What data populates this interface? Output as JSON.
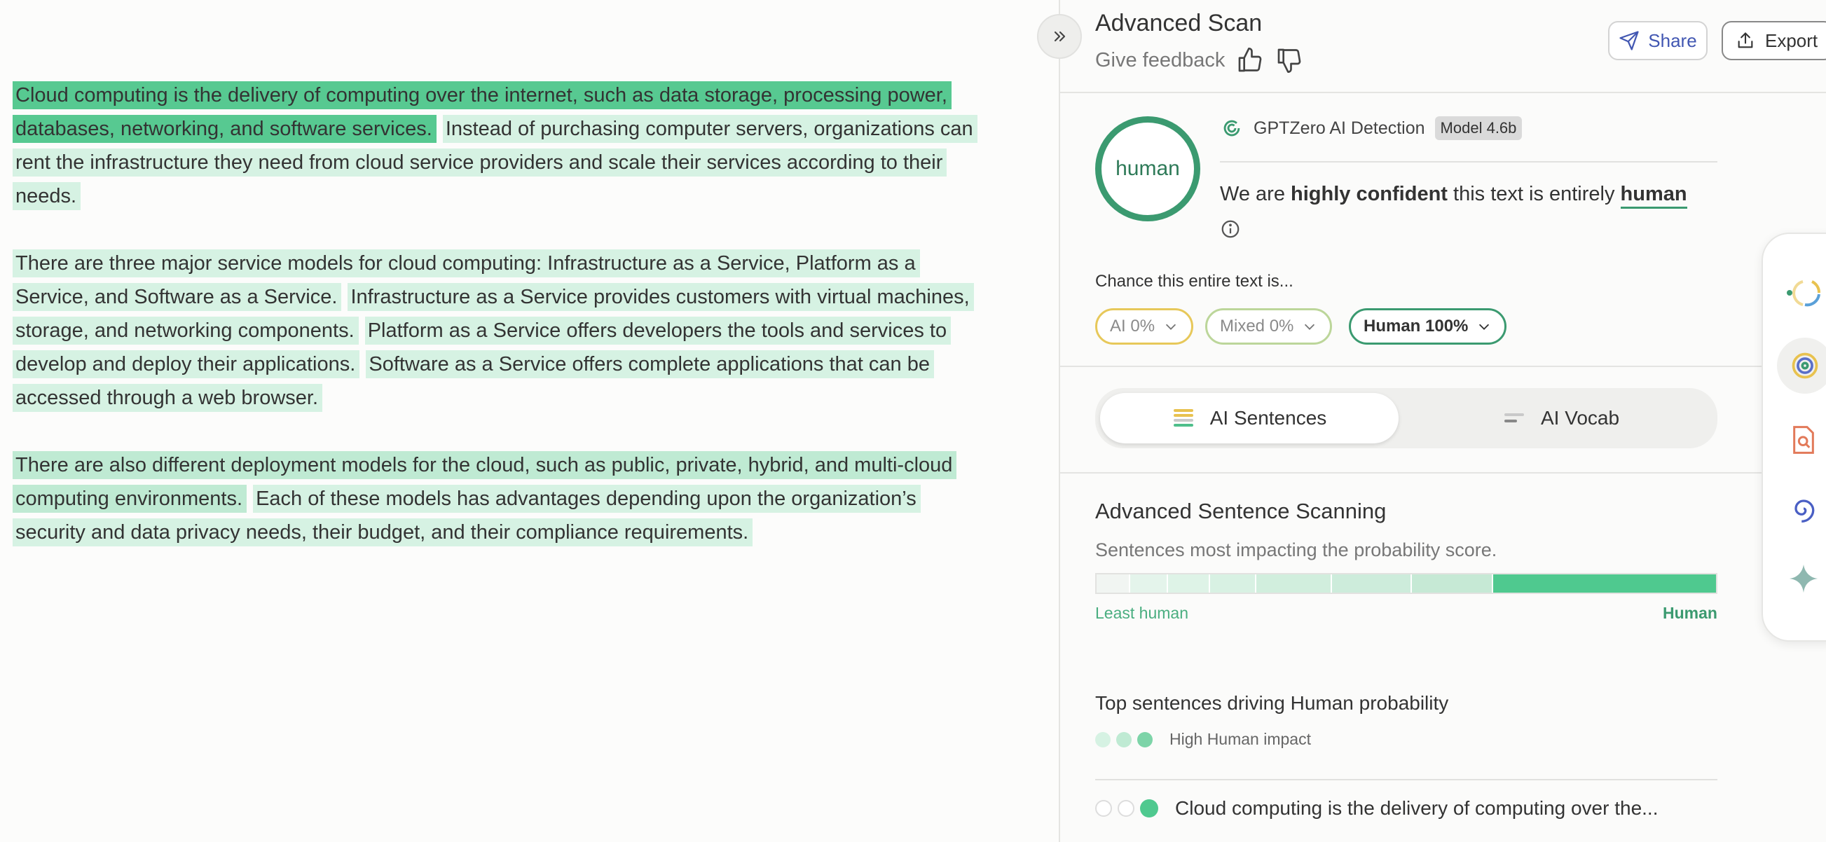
{
  "document": {
    "paragraphs": [
      [
        {
          "text": "Cloud computing is the delivery of computing over the internet, such as data storage, processing power, databases, networking, and software services.",
          "level": 3
        },
        {
          "text": "Instead of purchasing computer servers, organizations can rent the infrastructure they need from cloud service providers and scale their services according to their needs.",
          "level": 1
        }
      ],
      [
        {
          "text": "There are three major service models for cloud computing: Infrastructure as a Service, Platform as a Service, and Software as a Service.",
          "level": 1
        },
        {
          "text": "Infrastructure as a Service provides customers with virtual machines, storage, and networking components.",
          "level": 1
        },
        {
          "text": "Platform as a Service offers developers the tools and services to develop and deploy their applications.",
          "level": 1
        },
        {
          "text": "Software as a Service offers complete applications that can be accessed through a web browser.",
          "level": 1
        }
      ],
      [
        {
          "text": "There are also different deployment models for the cloud, such as public, private, hybrid, and multi-cloud computing environments.",
          "level": 2
        },
        {
          "text": "Each of these models has advantages depending upon the organization’s security and data privacy needs, their budget, and their compliance requirements.",
          "level": 1
        }
      ]
    ]
  },
  "panel": {
    "title": "Advanced Scan",
    "feedback_label": "Give feedback",
    "share_label": "Share",
    "export_label": "Export",
    "result_label": "human",
    "detector_name": "GPTZero AI Detection",
    "model_badge": "Model 4.6b",
    "verdict_pre": "We are ",
    "verdict_bold": "highly confident",
    "verdict_mid": " this text is entirely ",
    "verdict_class": "human",
    "chance_label": "Chance this entire text is...",
    "pills": {
      "ai": "AI 0%",
      "mixed": "Mixed 0%",
      "human": "Human 100%"
    },
    "tabs": {
      "sentences": "AI Sentences",
      "vocab": "AI Vocab"
    },
    "section_title": "Advanced Sentence Scanning",
    "section_subtitle": "Sentences most impacting the probability score.",
    "scale_left": "Least human",
    "scale_right": "Human",
    "top_title": "Top sentences driving Human probability",
    "impact_label": "High Human impact",
    "top_sentence": "Cloud computing is the delivery of computing over the..."
  },
  "colors": {
    "highlight_light": "#d6f2e3",
    "highlight_mid": "#bfead3",
    "highlight_strong": "#57c991",
    "human_green": "#3b9a70",
    "ai_yellow": "#e7c85a",
    "mixed_green": "#bcd69a",
    "share_blue": "#4257b2"
  }
}
